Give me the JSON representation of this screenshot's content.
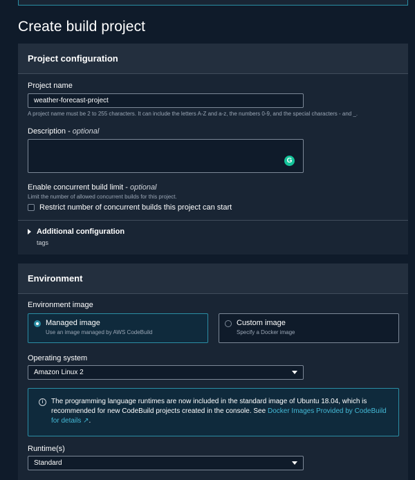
{
  "page": {
    "title": "Create build project"
  },
  "project_config": {
    "header": "Project configuration",
    "name_label": "Project name",
    "name_value": "weather-forecast-project",
    "name_hint": "A project name must be 2 to 255 characters. It can include the letters A-Z and a-z, the numbers 0-9, and the special characters - and _.",
    "description_label": "Description - ",
    "description_optional": "optional",
    "concurrent_label": "Enable concurrent build limit - ",
    "concurrent_optional": "optional",
    "concurrent_hint": "Limit the number of allowed concurrent builds for this project.",
    "concurrent_checkbox_label": "Restrict number of concurrent builds this project can start",
    "additional_label": "Additional configuration",
    "additional_sub": "tags"
  },
  "environment": {
    "header": "Environment",
    "image_label": "Environment image",
    "managed_title": "Managed image",
    "managed_desc": "Use an image managed by AWS CodeBuild",
    "custom_title": "Custom image",
    "custom_desc": "Specify a Docker image",
    "os_label": "Operating system",
    "os_value": "Amazon Linux 2",
    "info_text": "The programming language runtimes are now included in the standard image of Ubuntu 18.04, which is recommended for new CodeBuild projects created in the console. See ",
    "info_link": "Docker Images Provided by CodeBuild for details",
    "info_link_icon": "↗",
    "info_end": ".",
    "runtime_label": "Runtime(s)",
    "runtime_value": "Standard"
  },
  "icons": {
    "info": "i",
    "grammarly": "G"
  },
  "colors": {
    "background": "#0f1b2a",
    "panel": "#192534",
    "accent": "#2b8ea5",
    "link": "#44b9d6"
  }
}
